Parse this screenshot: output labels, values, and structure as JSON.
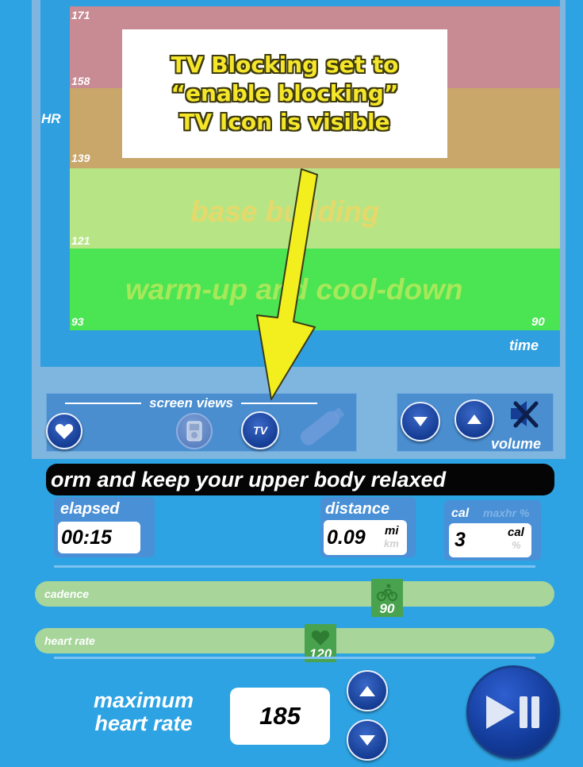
{
  "chart": {
    "y_axis_label": "HR",
    "x_axis_label": "time",
    "ticks": [
      "171",
      "158",
      "139",
      "121",
      "93"
    ],
    "time_end": "90",
    "zones": [
      {
        "name": "",
        "color": "#c88a93"
      },
      {
        "name": "",
        "color": "#c9a76b"
      },
      {
        "name": "base building",
        "color": "#b7e585"
      },
      {
        "name": "warm-up and cool-down",
        "color": "#4be452"
      }
    ]
  },
  "annotation": {
    "lines": [
      "TV Blocking set to",
      "“enable blocking”",
      "TV  Icon is visible"
    ]
  },
  "screen_views": {
    "title": "screen views",
    "buttons": [
      {
        "icon": "heart-icon"
      },
      {
        "icon": "ipod-icon"
      },
      {
        "icon": "tv-icon",
        "label": "TV"
      },
      {
        "icon": "usb-icon"
      }
    ]
  },
  "volume": {
    "label": "volume",
    "icons": [
      "volume-down-icon",
      "volume-up-icon",
      "mute-icon"
    ]
  },
  "message": "orm and keep your upper body relaxed",
  "stats": {
    "elapsed": {
      "label": "elapsed",
      "value": "00:15"
    },
    "distance": {
      "label": "distance",
      "value": "0.09",
      "unit_primary": "mi",
      "unit_secondary": "km"
    },
    "cal": {
      "label": "cal",
      "alt_label": "maxhr %",
      "value": "3",
      "unit_primary": "cal",
      "unit_secondary": "%"
    }
  },
  "sliders": {
    "cadence": {
      "label": "cadence",
      "value": "90"
    },
    "heart_rate": {
      "label": "heart rate",
      "value": "120"
    }
  },
  "max_heart_rate": {
    "label": "maximum heart rate",
    "value": "185"
  },
  "colors": {
    "background": "#2ea3e3",
    "button": "#153d94",
    "callout_text": "#f5e62a",
    "slider_thumb": "#49a24d"
  }
}
